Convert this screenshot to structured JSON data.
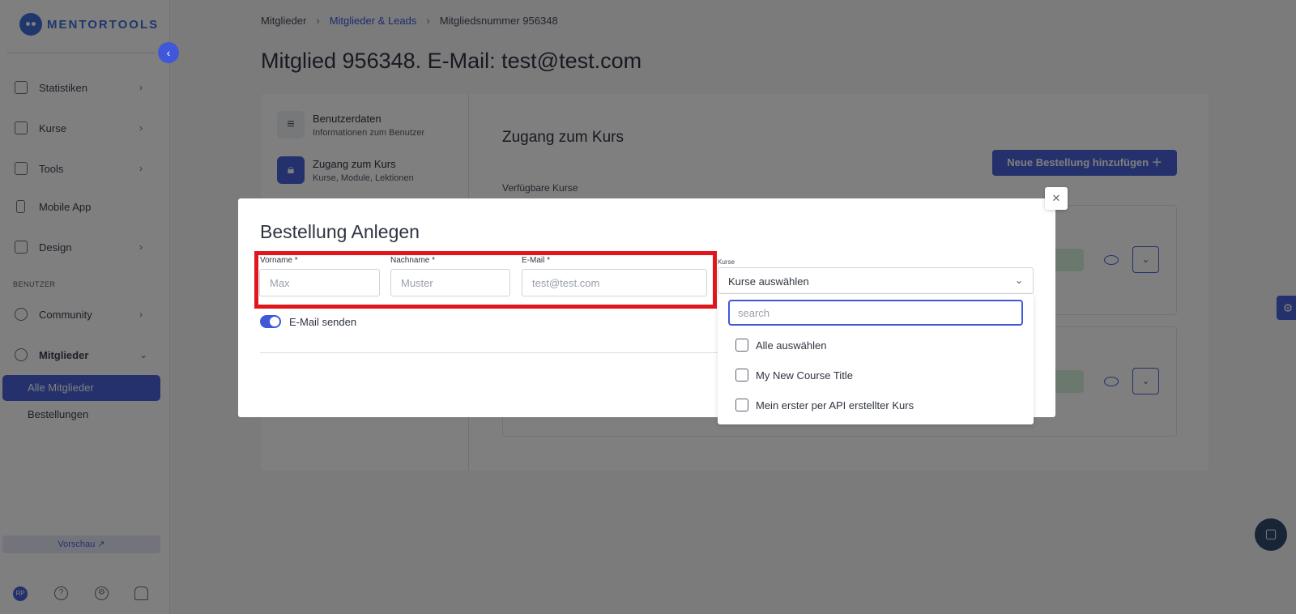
{
  "sidebar": {
    "logo": "MENTORTOOLS",
    "items": [
      {
        "label": "Statistiken",
        "icon": "bar-chart-icon"
      },
      {
        "label": "Kurse",
        "icon": "book-icon"
      },
      {
        "label": "Tools",
        "icon": "megaphone-icon"
      },
      {
        "label": "Mobile App",
        "icon": "phone-icon"
      },
      {
        "label": "Design",
        "icon": "edit-icon"
      },
      {
        "label": "Community",
        "icon": "users-icon"
      },
      {
        "label": "Mitglieder",
        "icon": "user-icon"
      }
    ],
    "section_label": "BENUTZER",
    "sub_items": [
      "Alle Mitglieder",
      "Bestellungen"
    ],
    "preview_label": "Vorschau ↗",
    "avatar_initials": "RP"
  },
  "breadcrumb": [
    "Mitglieder",
    "Mitglieder & Leads",
    "Mitgliedsnummer 956348"
  ],
  "page_title": "Mitglied 956348. E-Mail: test@test.com",
  "tabs": [
    {
      "title": "Benutzerdaten",
      "subtitle": "Informationen zum Benutzer",
      "icon": "database-icon"
    },
    {
      "title": "Zugang zum Kurs",
      "subtitle": "Kurse, Module, Lektionen",
      "icon": "lock-icon"
    }
  ],
  "section_title": "Zugang zum Kurs",
  "new_order_button": "Neue Bestellung hinzufügen ＋",
  "available_courses_label": "Verfügbare Kurse",
  "modal": {
    "title": "Bestellung Anlegen",
    "fields": [
      {
        "label": "Vorname *",
        "placeholder": "Max"
      },
      {
        "label": "Nachname *",
        "placeholder": "Muster"
      },
      {
        "label": "E-Mail *",
        "placeholder": "test@test.com"
      }
    ],
    "email_toggle_label": "E-Mail senden",
    "email_toggle_on": true,
    "courses_label": "Kurse",
    "courses_select_value": "Kurse auswählen",
    "search_placeholder": "search",
    "options": [
      "Alle auswählen",
      "My New Course Title",
      "Mein erster per API erstellter Kurs"
    ]
  },
  "colors": {
    "accent": "#4a62d8",
    "highlight": "#e0161d"
  }
}
